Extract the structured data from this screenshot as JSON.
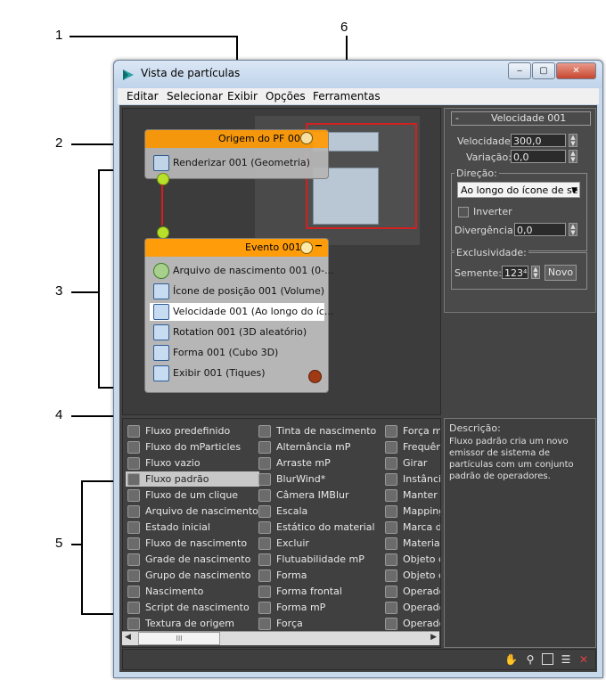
{
  "callouts": [
    "1",
    "2",
    "3",
    "4",
    "5",
    "6"
  ],
  "window": {
    "title": "Vista de partículas",
    "buttons": {
      "minimize": "‒",
      "maximize": "▢",
      "close": "✕"
    }
  },
  "menu": [
    "Editar",
    "Selecionar",
    "Exibir",
    "Opções",
    "Ferramentas"
  ],
  "graph": {
    "source_node": {
      "title": "Origem do PF 001",
      "operator": "Renderizar 001 (Geometria)"
    },
    "event_node": {
      "title": "Evento 001",
      "collapse": "−",
      "operators": [
        {
          "label": "Arquivo de nascimento 001 (0-...",
          "icon": "birth-file-icon"
        },
        {
          "label": "Ícone de posição 001 (Volume)",
          "icon": "position-icon"
        },
        {
          "label": "Velocidade 001 (Ao longo do íc...",
          "icon": "speed-icon"
        },
        {
          "label": "Rotation 001 (3D aleatório)",
          "icon": "rotation-icon"
        },
        {
          "label": "Forma 001 (Cubo 3D)",
          "icon": "shape-icon"
        },
        {
          "label": "Exibir 001 (Tiques)",
          "icon": "display-icon"
        }
      ]
    }
  },
  "params": {
    "rollout_title": "Velocidade 001",
    "rollout_toggle": "-",
    "speed_label": "Velocidade:",
    "speed_value": "300,0",
    "variation_label": "Variação:",
    "variation_value": "0,0",
    "direction_label": "Direção:",
    "direction_value": "Ao longo do ícone de se",
    "invert_label": "Inverter",
    "divergence_label": "Divergência:",
    "divergence_value": "0,0",
    "uniqueness_label": "Exclusividade:",
    "seed_label": "Semente:",
    "seed_value": "123⁴",
    "new_button": "Novo"
  },
  "depot": {
    "col1": [
      "Fluxo predefinido",
      "Fluxo do mParticles",
      "Fluxo vazio",
      "Fluxo padrão",
      "Fluxo de um clique",
      "Arquivo de nascimento",
      "Estado inicial",
      "Fluxo de nascimento",
      "Grade de nascimento",
      "Grupo de nascimento",
      "Nascimento",
      "Script de nascimento",
      "Textura de origem"
    ],
    "col2": [
      "Tinta de nascimento",
      "Alternância mP",
      "Arraste mP",
      "BlurWind*",
      "Câmera IMBlur",
      "Escala",
      "Estático do material",
      "Excluir",
      "Flutuabilidade mP",
      "Forma",
      "Forma frontal",
      "Forma mP",
      "Força"
    ],
    "col3": [
      "Força m",
      "Frequên",
      "Girar",
      "Instânci",
      "Manter s",
      "Mapping",
      "Marca d",
      "Material",
      "Objeto d",
      "Objeto c",
      "Operado",
      "Operado",
      "Operado"
    ],
    "selected": "Fluxo padrão",
    "scroll_left": "◀",
    "scroll_right": "▶",
    "scroll_thumb": "III"
  },
  "description": {
    "label": "Descrição:",
    "text": "Fluxo padrão cria um novo emissor de sistema de partículas com um conjunto padrão de operadores."
  },
  "status_icons": [
    "pan-icon",
    "zoom-icon",
    "zoom-region-icon",
    "zoom-extents-icon",
    "no-zoom-icon"
  ]
}
